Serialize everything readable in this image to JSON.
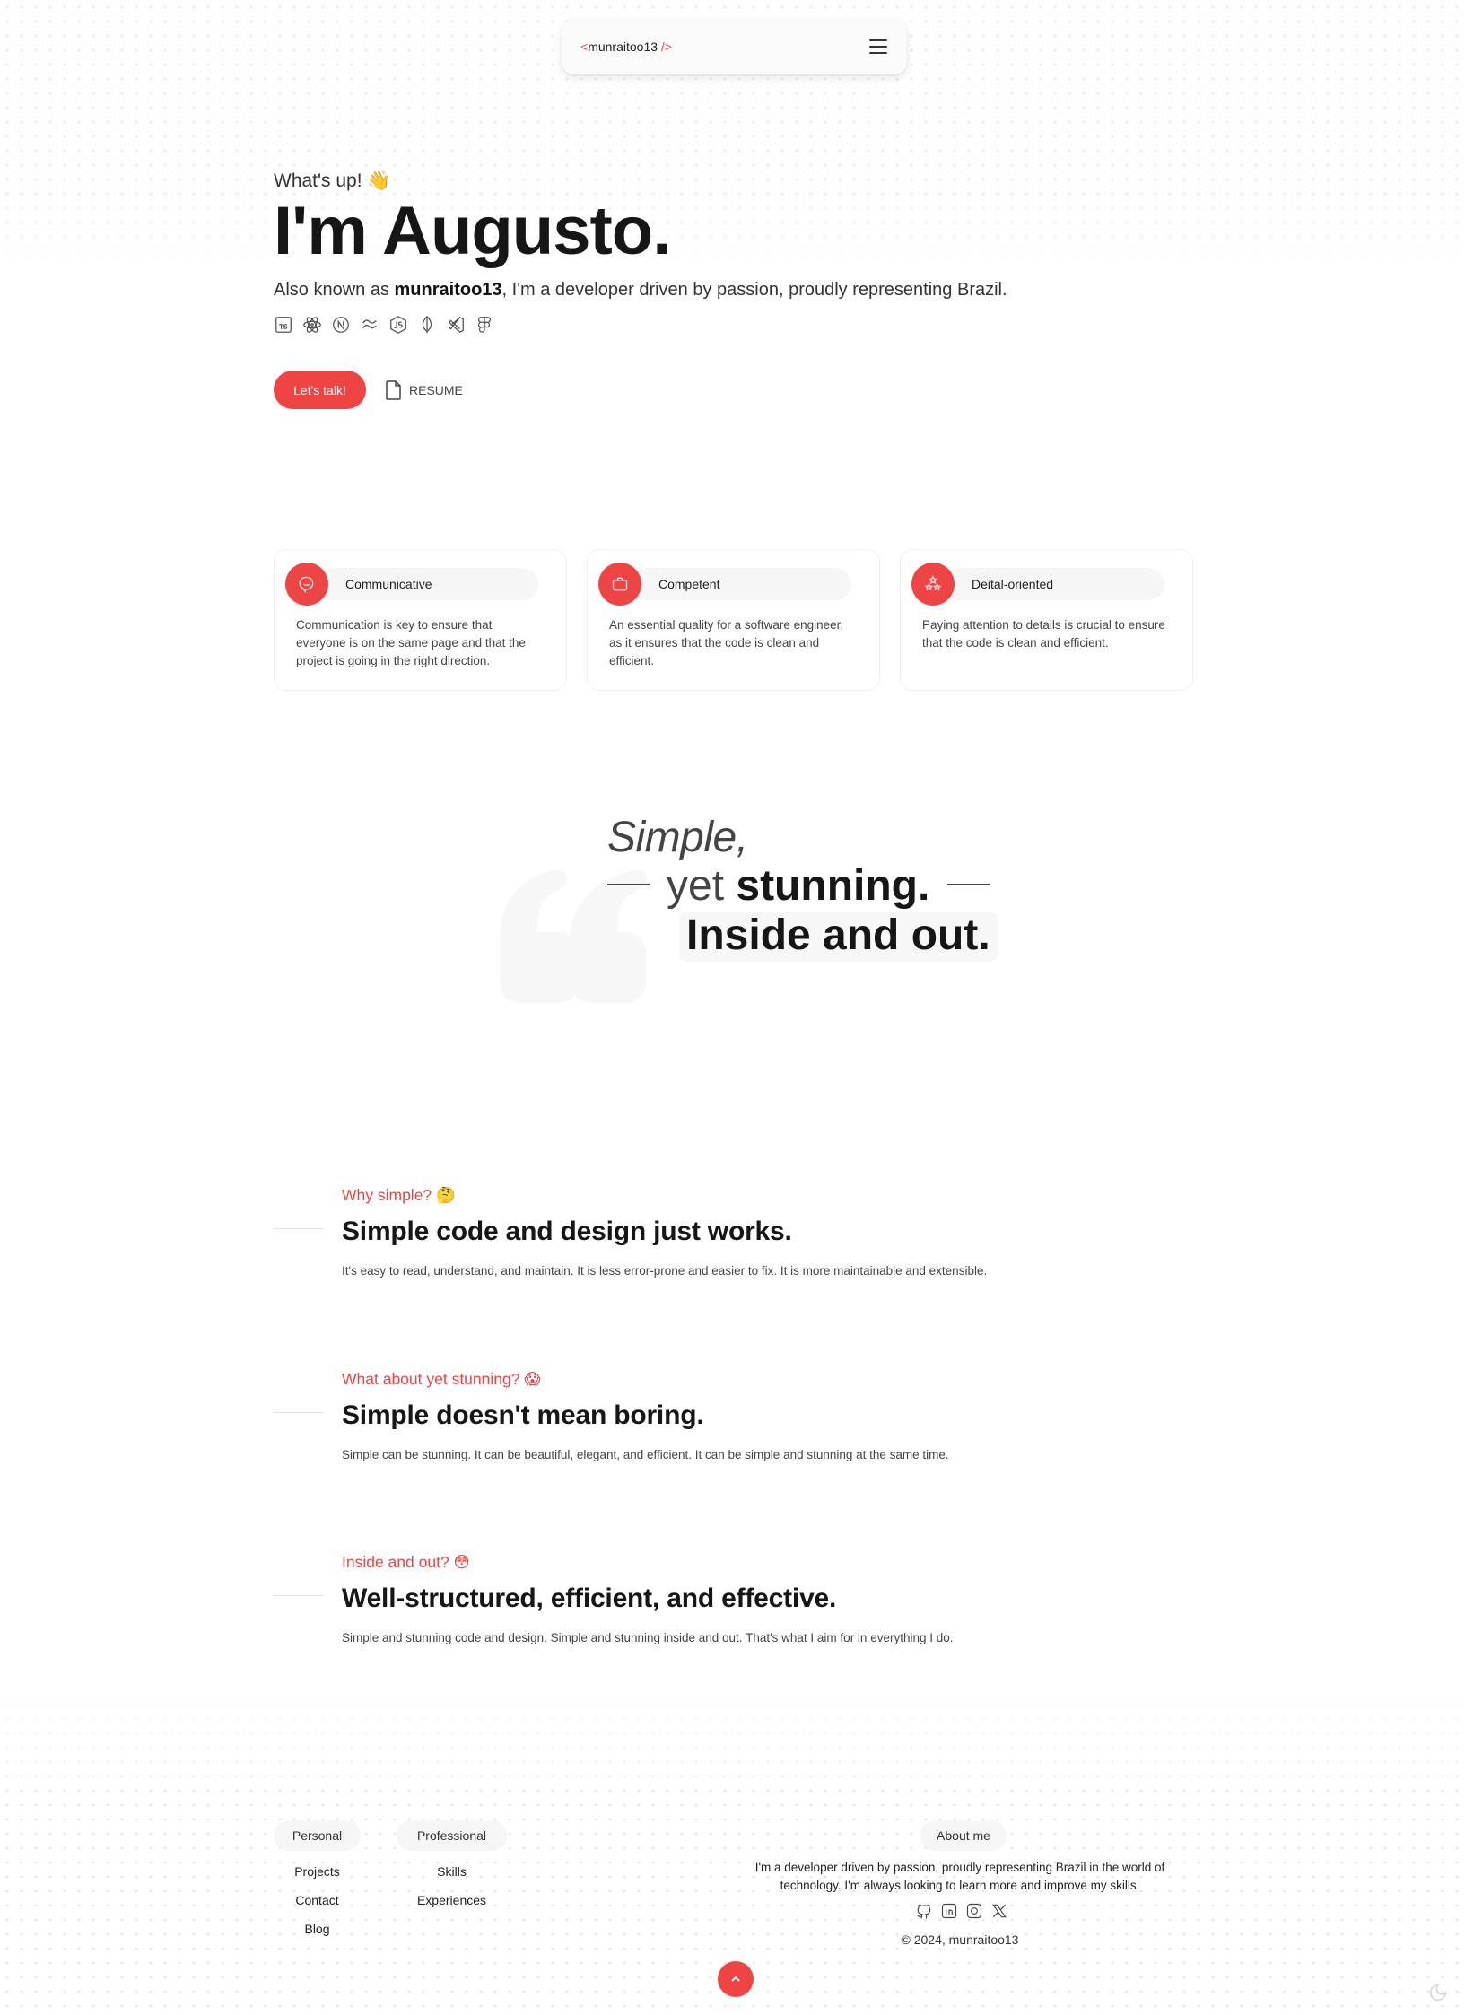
{
  "nav": {
    "logo_open": "<",
    "logo_name": "munraitoo13",
    "logo_close": " />",
    "menu_icon": "hamburger-menu-icon"
  },
  "hero": {
    "greeting": "What's up! 👋",
    "title": "I'm Augusto.",
    "subtitle_prefix": "Also known as ",
    "subtitle_handle": "munraitoo13",
    "subtitle_suffix": ", I'm a developer driven by passion, proudly representing Brazil.",
    "tech_icons": [
      "typescript-icon",
      "react-icon",
      "nextjs-icon",
      "tailwind-icon",
      "nodejs-icon",
      "mongodb-icon",
      "vscode-icon",
      "figma-icon"
    ],
    "cta_label": "Let's talk!",
    "resume_label": "RESUME"
  },
  "cards": [
    {
      "icon": "chat-bubble-icon",
      "title": "Communicative",
      "text": "Communication is key to ensure that everyone is on the same page and that the project is going in the right direction."
    },
    {
      "icon": "briefcase-icon",
      "title": "Competent",
      "text": "An essential quality for a software engineer, as it ensures that the code is clean and efficient."
    },
    {
      "icon": "stars-icon",
      "title": "Deital-oriented",
      "text": "Paying attention to details is crucial to ensure that the code is clean and efficient."
    }
  ],
  "quote": {
    "line1": "Simple,",
    "line2_light": "yet ",
    "line2_bold": "stunning.",
    "line3": "Inside and out."
  },
  "sections": [
    {
      "label": "Why simple? 🤔",
      "title": "Simple code and design just works.",
      "body": "It's easy to read, understand, and maintain. It is less error-prone and easier to fix. It is more maintainable and extensible."
    },
    {
      "label": "What about yet stunning? 😱",
      "title": "Simple doesn't mean boring.",
      "body": "Simple can be stunning. It can be beautiful, elegant, and efficient. It can be simple and stunning at the same time."
    },
    {
      "label": "Inside and out? 😳",
      "title": "Well-structured, efficient, and effective.",
      "body": "Simple and stunning code and design. Simple and stunning inside and out. That's what I aim for in everything I do."
    }
  ],
  "footer": {
    "personal": {
      "heading": "Personal",
      "links": [
        "Projects",
        "Contact",
        "Blog"
      ]
    },
    "professional": {
      "heading": "Professional",
      "links": [
        "Skills",
        "Experiences"
      ]
    },
    "about": {
      "heading": "About me",
      "text": "I'm a developer driven by passion, proudly representing Brazil in the world of technology. I'm always looking to learn more and improve my skills.",
      "social": [
        "github-icon",
        "linkedin-icon",
        "instagram-icon",
        "x-icon"
      ]
    },
    "copyright": "© 2024, munraitoo13"
  },
  "colors": {
    "accent": "#ef4444",
    "text": "#161616",
    "muted": "#444444",
    "pill_bg": "#f6f6f6"
  }
}
